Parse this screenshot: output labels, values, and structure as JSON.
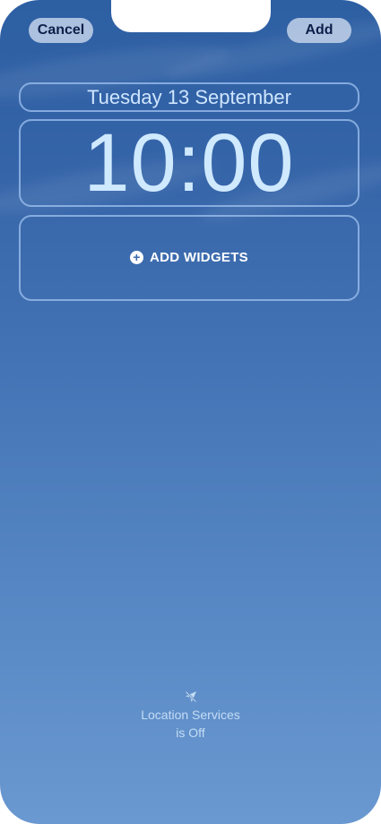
{
  "header": {
    "cancel_label": "Cancel",
    "add_label": "Add"
  },
  "lockscreen": {
    "date": "Tuesday 13 September",
    "time": "10:00",
    "add_widgets_label": "ADD WIDGETS"
  },
  "footer": {
    "location_line1": "Location Services",
    "location_line2": "is Off",
    "icon": "location-off-icon"
  },
  "colors": {
    "background_top": "#2d5fa3",
    "background_bottom": "#6a98d0",
    "text_light": "#cfe6ff",
    "button_text": "#0d1f4a"
  }
}
